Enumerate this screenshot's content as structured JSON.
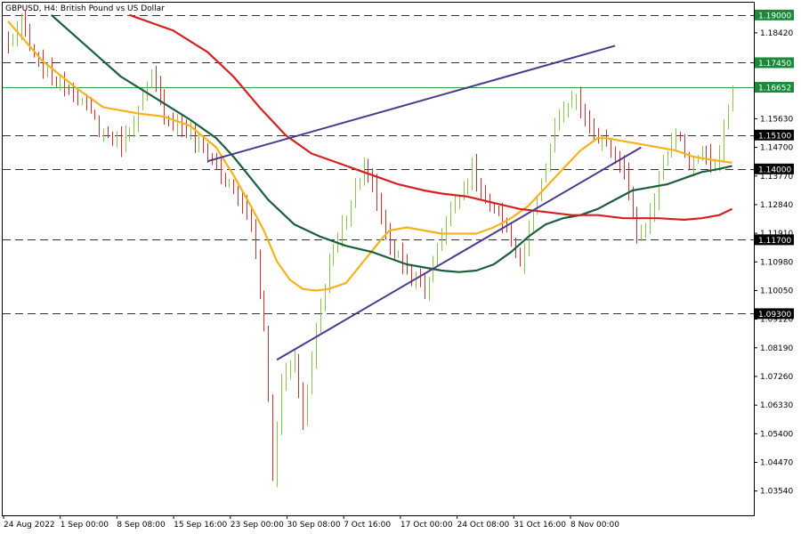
{
  "chart_data": {
    "type": "candlestick",
    "title": "GBPUSD, H4:  British Pound vs US Dollar",
    "ylim": [
      1.0275,
      1.194
    ],
    "y_ticks": [
      "1.18420",
      "1.15630",
      "1.14700",
      "1.13770",
      "1.12840",
      "1.11910",
      "1.10980",
      "1.10050",
      "1.09120",
      "1.08190",
      "1.07260",
      "1.06330",
      "1.05400",
      "1.04470",
      "1.03540"
    ],
    "x_ticks": [
      "24 Aug 2022",
      "1 Sep 00:00",
      "8 Sep 08:00",
      "15 Sep 16:00",
      "23 Sep 00:00",
      "30 Sep 08:00",
      "7 Oct 16:00",
      "17 Oct 00:00",
      "24 Oct 08:00",
      "31 Oct 16:00",
      "8 Nov 00:00"
    ],
    "n_bars": 168,
    "levels": [
      {
        "price": "1.19000",
        "style": "dashed",
        "tag_color": "#1a8a3a"
      },
      {
        "price": "1.17450",
        "style": "dashed",
        "tag_color": "#1a8a3a"
      },
      {
        "price": "1.16652",
        "style": "solid",
        "tag_color": "#1a8a3a"
      },
      {
        "price": "1.15100",
        "style": "dashed",
        "tag_color": "#000000"
      },
      {
        "price": "1.14000",
        "style": "dashed",
        "tag_color": "#000000"
      },
      {
        "price": "1.11700",
        "style": "dashed",
        "tag_color": "#000000"
      },
      {
        "price": "1.09300",
        "style": "dashed",
        "tag_color": "#000000"
      }
    ],
    "candle_colors": {
      "up": "#8bc34a",
      "down": "#d32f2f"
    },
    "anchors": [
      {
        "i": 0,
        "p": 1.18
      },
      {
        "i": 3,
        "p": 1.187
      },
      {
        "i": 6,
        "p": 1.176
      },
      {
        "i": 10,
        "p": 1.17
      },
      {
        "i": 16,
        "p": 1.163
      },
      {
        "i": 22,
        "p": 1.152
      },
      {
        "i": 26,
        "p": 1.148
      },
      {
        "i": 30,
        "p": 1.159
      },
      {
        "i": 33,
        "p": 1.17
      },
      {
        "i": 36,
        "p": 1.158
      },
      {
        "i": 42,
        "p": 1.151
      },
      {
        "i": 47,
        "p": 1.142
      },
      {
        "i": 52,
        "p": 1.133
      },
      {
        "i": 56,
        "p": 1.122
      },
      {
        "i": 59,
        "p": 1.09
      },
      {
        "i": 61,
        "p": 1.04
      },
      {
        "i": 63,
        "p": 1.072
      },
      {
        "i": 66,
        "p": 1.078
      },
      {
        "i": 68,
        "p": 1.059
      },
      {
        "i": 71,
        "p": 1.087
      },
      {
        "i": 74,
        "p": 1.11
      },
      {
        "i": 78,
        "p": 1.125
      },
      {
        "i": 82,
        "p": 1.142
      },
      {
        "i": 85,
        "p": 1.13
      },
      {
        "i": 88,
        "p": 1.115
      },
      {
        "i": 93,
        "p": 1.106
      },
      {
        "i": 96,
        "p": 1.1
      },
      {
        "i": 99,
        "p": 1.115
      },
      {
        "i": 103,
        "p": 1.13
      },
      {
        "i": 107,
        "p": 1.14
      },
      {
        "i": 111,
        "p": 1.127
      },
      {
        "i": 115,
        "p": 1.121
      },
      {
        "i": 118,
        "p": 1.108
      },
      {
        "i": 121,
        "p": 1.125
      },
      {
        "i": 124,
        "p": 1.14
      },
      {
        "i": 127,
        "p": 1.158
      },
      {
        "i": 131,
        "p": 1.162
      },
      {
        "i": 135,
        "p": 1.152
      },
      {
        "i": 139,
        "p": 1.146
      },
      {
        "i": 142,
        "p": 1.14
      },
      {
        "i": 145,
        "p": 1.116
      },
      {
        "i": 148,
        "p": 1.125
      },
      {
        "i": 151,
        "p": 1.143
      },
      {
        "i": 154,
        "p": 1.152
      },
      {
        "i": 157,
        "p": 1.141
      },
      {
        "i": 160,
        "p": 1.145
      },
      {
        "i": 163,
        "p": 1.14
      },
      {
        "i": 167,
        "p": 1.1665
      }
    ],
    "moving_averages": [
      {
        "color": "#f5b21b",
        "points": [
          [
            0,
            1.188
          ],
          [
            8,
            1.175
          ],
          [
            16,
            1.166
          ],
          [
            22,
            1.16
          ],
          [
            30,
            1.158
          ],
          [
            36,
            1.157
          ],
          [
            42,
            1.154
          ],
          [
            48,
            1.147
          ],
          [
            52,
            1.138
          ],
          [
            56,
            1.128
          ],
          [
            59,
            1.12
          ],
          [
            62,
            1.11
          ],
          [
            65,
            1.104
          ],
          [
            68,
            1.101
          ],
          [
            71,
            1.1005
          ],
          [
            74,
            1.101
          ],
          [
            78,
            1.103
          ],
          [
            82,
            1.11
          ],
          [
            86,
            1.117
          ],
          [
            88,
            1.12
          ],
          [
            92,
            1.121
          ],
          [
            96,
            1.12
          ],
          [
            100,
            1.119
          ],
          [
            104,
            1.119
          ],
          [
            108,
            1.119
          ],
          [
            112,
            1.121
          ],
          [
            116,
            1.124
          ],
          [
            120,
            1.128
          ],
          [
            124,
            1.134
          ],
          [
            128,
            1.14
          ],
          [
            132,
            1.146
          ],
          [
            136,
            1.15
          ],
          [
            138,
            1.15
          ],
          [
            142,
            1.149
          ],
          [
            146,
            1.148
          ],
          [
            150,
            1.147
          ],
          [
            154,
            1.146
          ],
          [
            158,
            1.144
          ],
          [
            162,
            1.143
          ],
          [
            167,
            1.142
          ]
        ]
      },
      {
        "color": "#1b5e3b",
        "points": [
          [
            10,
            1.19
          ],
          [
            18,
            1.18
          ],
          [
            26,
            1.17
          ],
          [
            34,
            1.163
          ],
          [
            42,
            1.156
          ],
          [
            48,
            1.15
          ],
          [
            52,
            1.144
          ],
          [
            56,
            1.137
          ],
          [
            60,
            1.13
          ],
          [
            66,
            1.122
          ],
          [
            72,
            1.118
          ],
          [
            78,
            1.115
          ],
          [
            84,
            1.113
          ],
          [
            88,
            1.111
          ],
          [
            92,
            1.109
          ],
          [
            96,
            1.108
          ],
          [
            100,
            1.107
          ],
          [
            104,
            1.1065
          ],
          [
            108,
            1.107
          ],
          [
            112,
            1.109
          ],
          [
            116,
            1.113
          ],
          [
            120,
            1.118
          ],
          [
            124,
            1.122
          ],
          [
            128,
            1.124
          ],
          [
            132,
            1.125
          ],
          [
            136,
            1.127
          ],
          [
            140,
            1.13
          ],
          [
            144,
            1.133
          ],
          [
            148,
            1.134
          ],
          [
            152,
            1.135
          ],
          [
            156,
            1.137
          ],
          [
            160,
            1.139
          ],
          [
            164,
            1.14
          ],
          [
            167,
            1.141
          ]
        ]
      },
      {
        "color": "#d62020",
        "points": [
          [
            28,
            1.19
          ],
          [
            38,
            1.185
          ],
          [
            46,
            1.178
          ],
          [
            52,
            1.17
          ],
          [
            58,
            1.16
          ],
          [
            64,
            1.151
          ],
          [
            70,
            1.145
          ],
          [
            76,
            1.142
          ],
          [
            82,
            1.139
          ],
          [
            86,
            1.137
          ],
          [
            90,
            1.135
          ],
          [
            96,
            1.133
          ],
          [
            100,
            1.132
          ],
          [
            106,
            1.131
          ],
          [
            112,
            1.129
          ],
          [
            118,
            1.127
          ],
          [
            124,
            1.126
          ],
          [
            130,
            1.125
          ],
          [
            136,
            1.125
          ],
          [
            142,
            1.124
          ],
          [
            146,
            1.124
          ],
          [
            150,
            1.124
          ],
          [
            156,
            1.1235
          ],
          [
            160,
            1.124
          ],
          [
            164,
            1.125
          ],
          [
            167,
            1.127
          ]
        ]
      }
    ],
    "trendlines": [
      {
        "color": "#4b3a8c",
        "from": [
          46,
          1.1425
        ],
        "to": [
          140,
          1.18
        ]
      },
      {
        "color": "#4b3a8c",
        "from": [
          62,
          1.078
        ],
        "to": [
          146,
          1.147
        ]
      }
    ]
  }
}
